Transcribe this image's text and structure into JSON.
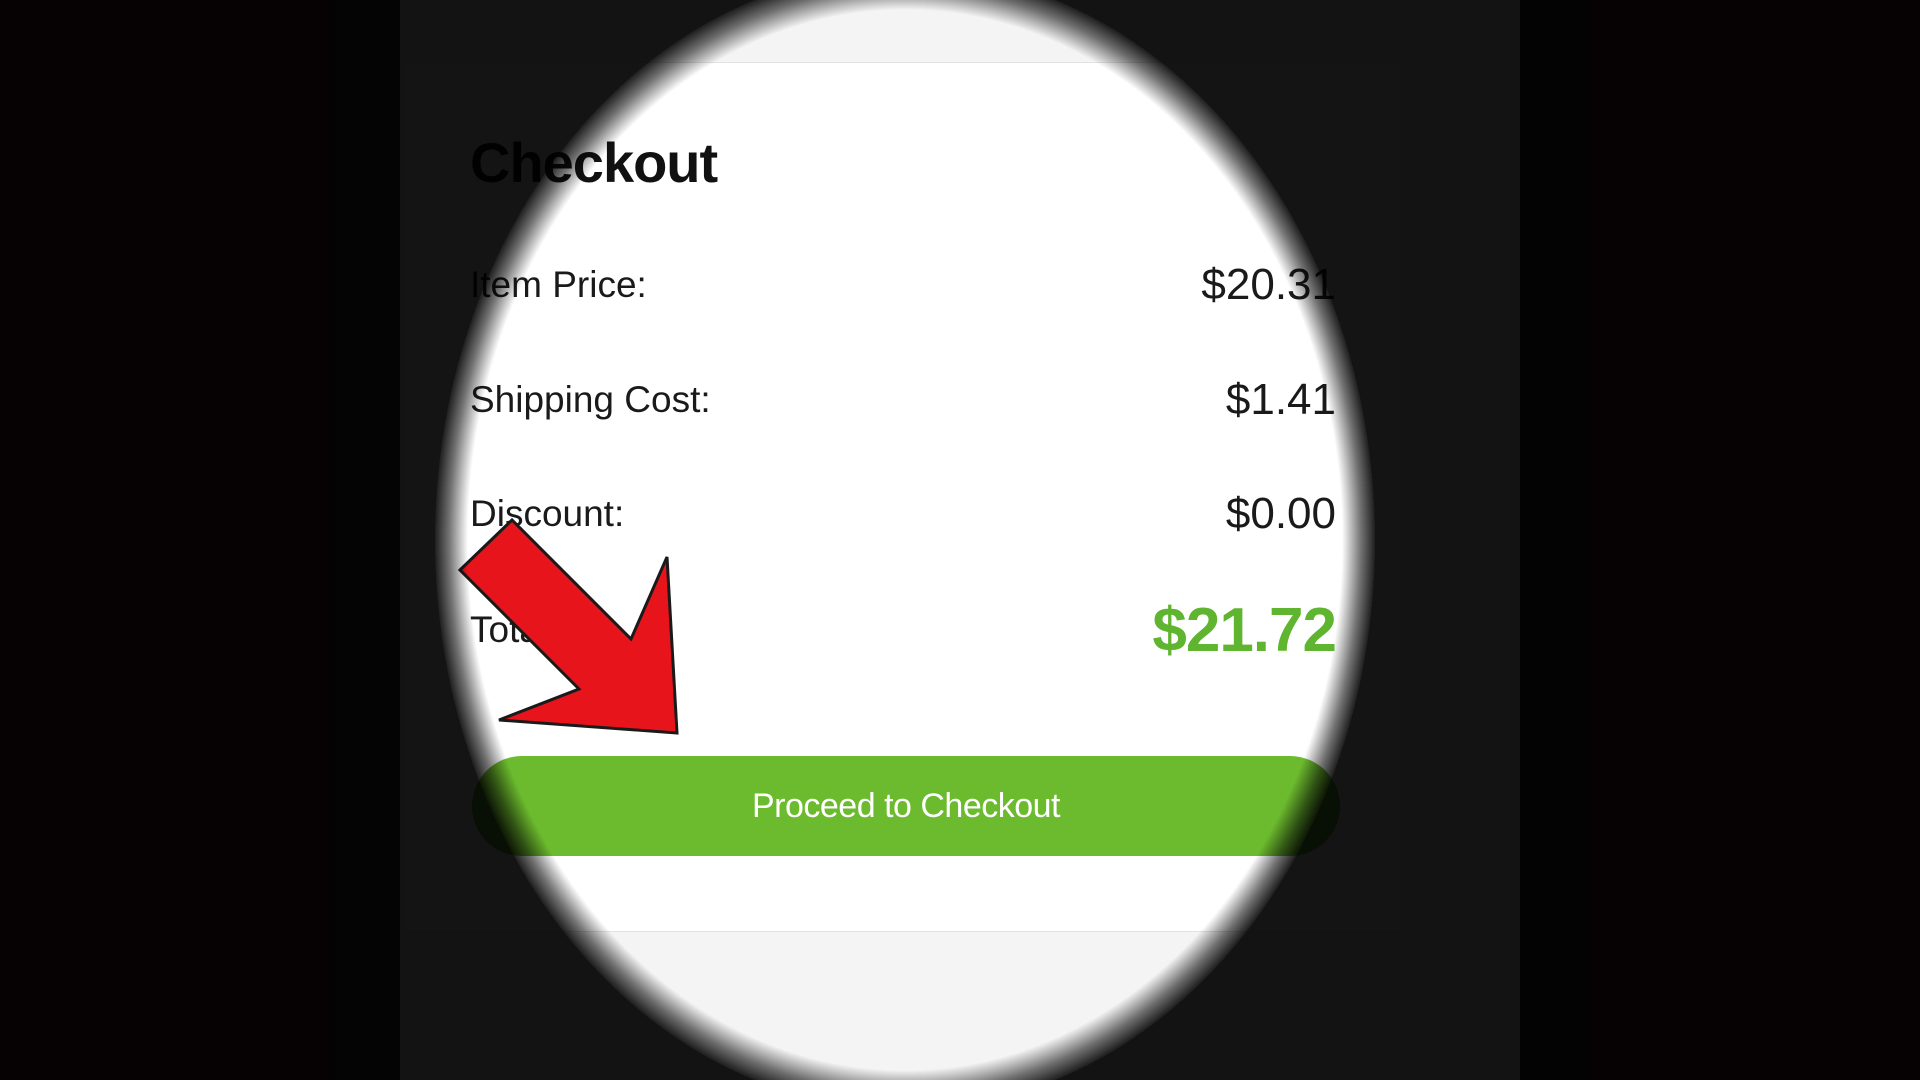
{
  "checkout": {
    "title": "Checkout",
    "rows": [
      {
        "label": "Item Price:",
        "value": "$20.31"
      },
      {
        "label": "Shipping Cost:",
        "value": "$1.41"
      },
      {
        "label": "Discount:",
        "value": "$0.00"
      },
      {
        "label": "Total:",
        "value": "$21.72"
      }
    ],
    "button_label": "Proceed to Checkout"
  },
  "colors": {
    "accent_green": "#6cbb2e",
    "total_green": "#5fb52f",
    "arrow_red": "#e8141c"
  },
  "icons": {
    "annotation": "red-arrow-icon"
  }
}
